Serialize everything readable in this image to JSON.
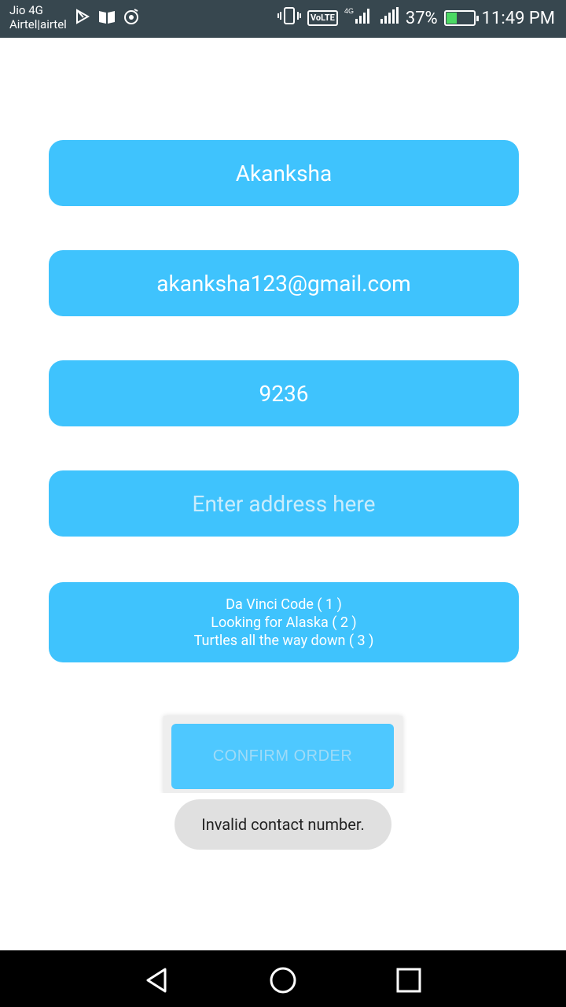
{
  "status_bar": {
    "carrier_line1": "Jio 4G",
    "carrier_line2": "Airtel|airtel",
    "volte": "VoLTE",
    "network": "4G",
    "battery_percent": "37%",
    "battery_level": 0.37,
    "time": "11:49 PM",
    "icons": [
      "play-store-icon",
      "book-icon",
      "music-icon",
      "vibrate-icon",
      "signal-icon",
      "battery-charging-icon"
    ]
  },
  "form": {
    "name_value": "Akanksha",
    "email_value": "akanksha123@gmail.com",
    "contact_value": "9236",
    "address_placeholder": "Enter address here",
    "books": [
      "Da Vinci Code ( 1 )",
      "Looking for Alaska ( 2 )",
      "Turtles all the way down ( 3 )"
    ],
    "confirm_label": "CONFIRM ORDER"
  },
  "toast": {
    "message": "Invalid contact number."
  },
  "nav_bar": {
    "icons": [
      "back-icon",
      "home-icon",
      "recents-icon"
    ]
  },
  "colors": {
    "field_bg": "#3fc3fd",
    "status_bar_bg": "#37474f",
    "toast_bg": "#e0e0e0"
  }
}
